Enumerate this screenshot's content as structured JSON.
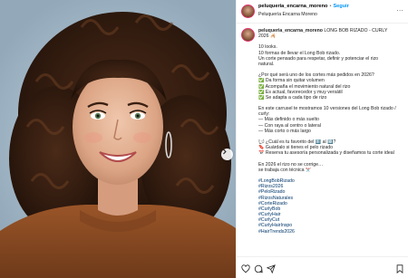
{
  "header": {
    "username": "peluqueria_encarna_moreno",
    "separator": "•",
    "follow_label": "Seguir",
    "subtitle": "Peluquería Encarna Moreno",
    "more_label": "..."
  },
  "caption": {
    "username": "peluqueria_encarna_moreno",
    "title": "LONG BOB RIZADO - CURLY",
    "title_line2": "2026 🦂",
    "lines": [
      "",
      "10 looks.",
      "10 formas de llevar el Long Bob rizado.",
      "Un corte pensado para respetar, definir y potenciar el rizo",
      "natural.",
      "",
      "¿Por qué será uno de los cortes más pedidos en 2026?",
      "✅ Da forma sin quitar volumen",
      "✅ Acompaña el movimiento natural del rizo",
      "✅ Es actual, favorecedor y muy versátil",
      "✅ Se adapta a cada tipo de rizo",
      "",
      "En este carrusel te mostramos 10 versiones del Long Bob rizado /",
      "curly:",
      "— Más definido o más suelto",
      "— Con raya al centro o lateral",
      "— Más corto o más largo",
      "",
      "💬 ¿Cuál es tu favorito del 1️⃣ al 🔟?",
      "🔖 Guárdalo si tienes el pelo rizado",
      "📅 Reserva tu asesoría personalizada y diseñamos tu corte ideal",
      "",
      "En 2026 el rizo no se corrige…",
      "se trabaja con técnica ✂️",
      ""
    ],
    "hashtags": [
      "#LongBobRizado",
      "#Rizos2026",
      "#PeloRizado",
      "#RizosNaturales",
      "#CorteRizado",
      "#CurlyBob",
      "#CurlyHair",
      "#CurlyCut",
      "#CurlyHairInspo",
      "#HairTrends2026"
    ]
  },
  "icons": {
    "like": "heart-icon",
    "comment": "comment-icon",
    "share": "share-icon",
    "save": "bookmark-icon",
    "next": "chevron-right-icon",
    "more": "more-icon"
  },
  "colors": {
    "follow": "#0095f6",
    "hashtag": "#00376b",
    "avatar_ring": "#e1306c"
  }
}
